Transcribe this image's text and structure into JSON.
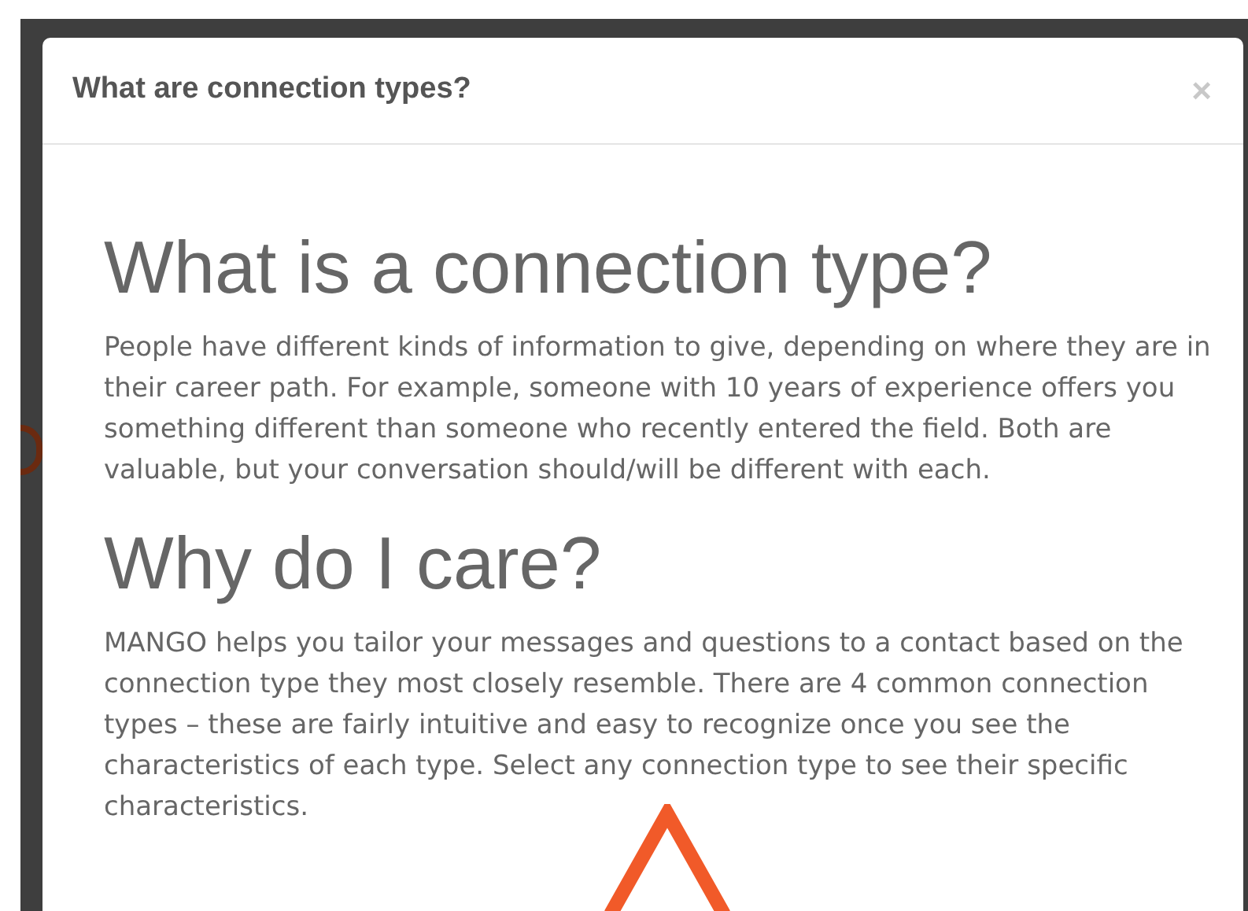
{
  "modal": {
    "title": "What are connection types?",
    "close": "×",
    "sections": [
      {
        "heading": "What is a connection type?",
        "text": "People have different kinds of information to give, depending on where they are in their career path. For example, someone with 10 years of experience offers you something different than someone who recently entered the field. Both are valuable, but your conversation should/will be different with each."
      },
      {
        "heading": "Why do I care?",
        "text": "MANGO helps you tailor your messages and questions to a contact based on the connection type they most closely resemble. There are 4 common connection types – these are fairly intuitive and easy to recognize once you see the characteristics of each type. Select any connection type to see their specific characteristics."
      }
    ]
  }
}
